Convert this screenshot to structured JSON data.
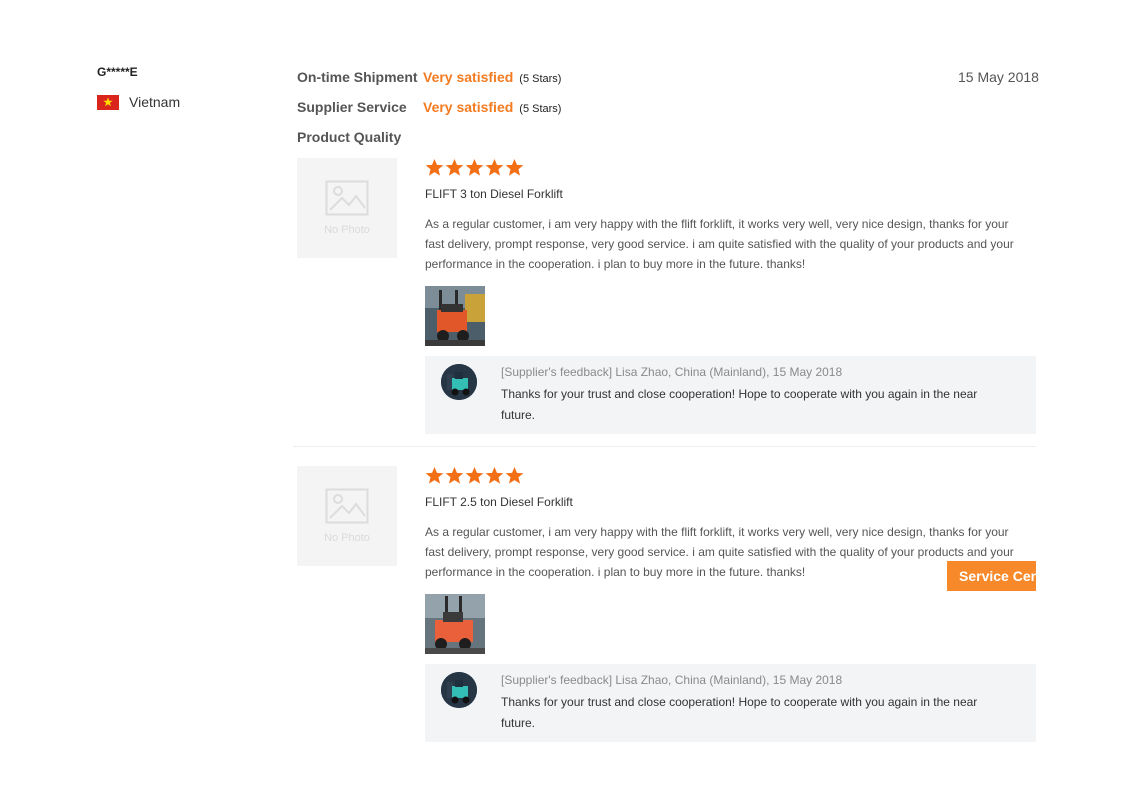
{
  "reviewer": {
    "name": "G*****E",
    "country": "Vietnam",
    "flag_icon": "vietnam-flag-icon"
  },
  "ratings": [
    {
      "label": "On-time Shipment",
      "value": "Very satisfied",
      "stars_text": "(5 Stars)",
      "stars": 5
    },
    {
      "label": "Supplier Service",
      "value": "Very satisfied",
      "stars_text": "(5 Stars)",
      "stars": 5
    },
    {
      "label": "Product Quality",
      "value": "",
      "stars_text": ""
    }
  ],
  "review_date": "15 May 2018",
  "reviews": [
    {
      "placeholder_text": "No Photo",
      "rating": 5,
      "product_name": "FLIFT 3 ton Diesel Forklift",
      "text": "As a regular customer, i am very happy with the flift forklift, it works very well, very nice design, thanks for your fast delivery, prompt response, very good service. i am quite satisfied with the quality of your products and your performance in the cooperation. i plan to buy more in the future. thanks!",
      "feedback": {
        "meta": "[Supplier's feedback] Lisa Zhao, China (Mainland), 15 May 2018",
        "text": "Thanks for your trust and close cooperation! Hope to cooperate with you again in the near future."
      }
    },
    {
      "placeholder_text": "No Photo",
      "rating": 5,
      "product_name": "FLIFT 2.5 ton Diesel Forklift",
      "text": "As a regular customer, i am very happy with the flift forklift, it works very well, very nice design, thanks for your fast delivery, prompt response, very good service. i am quite satisfied with the quality of your products and your performance in the cooperation. i plan to buy more in the future. thanks!",
      "feedback": {
        "meta": "[Supplier's feedback] Lisa Zhao, China (Mainland), 15 May 2018",
        "text": "Thanks for your trust and close cooperation! Hope to cooperate with you again in the near future."
      }
    }
  ],
  "service_center": {
    "label": "Service Center"
  },
  "colors": {
    "accent": "#f37b20",
    "star": "#f36f16",
    "service_button": "#f7892b"
  }
}
